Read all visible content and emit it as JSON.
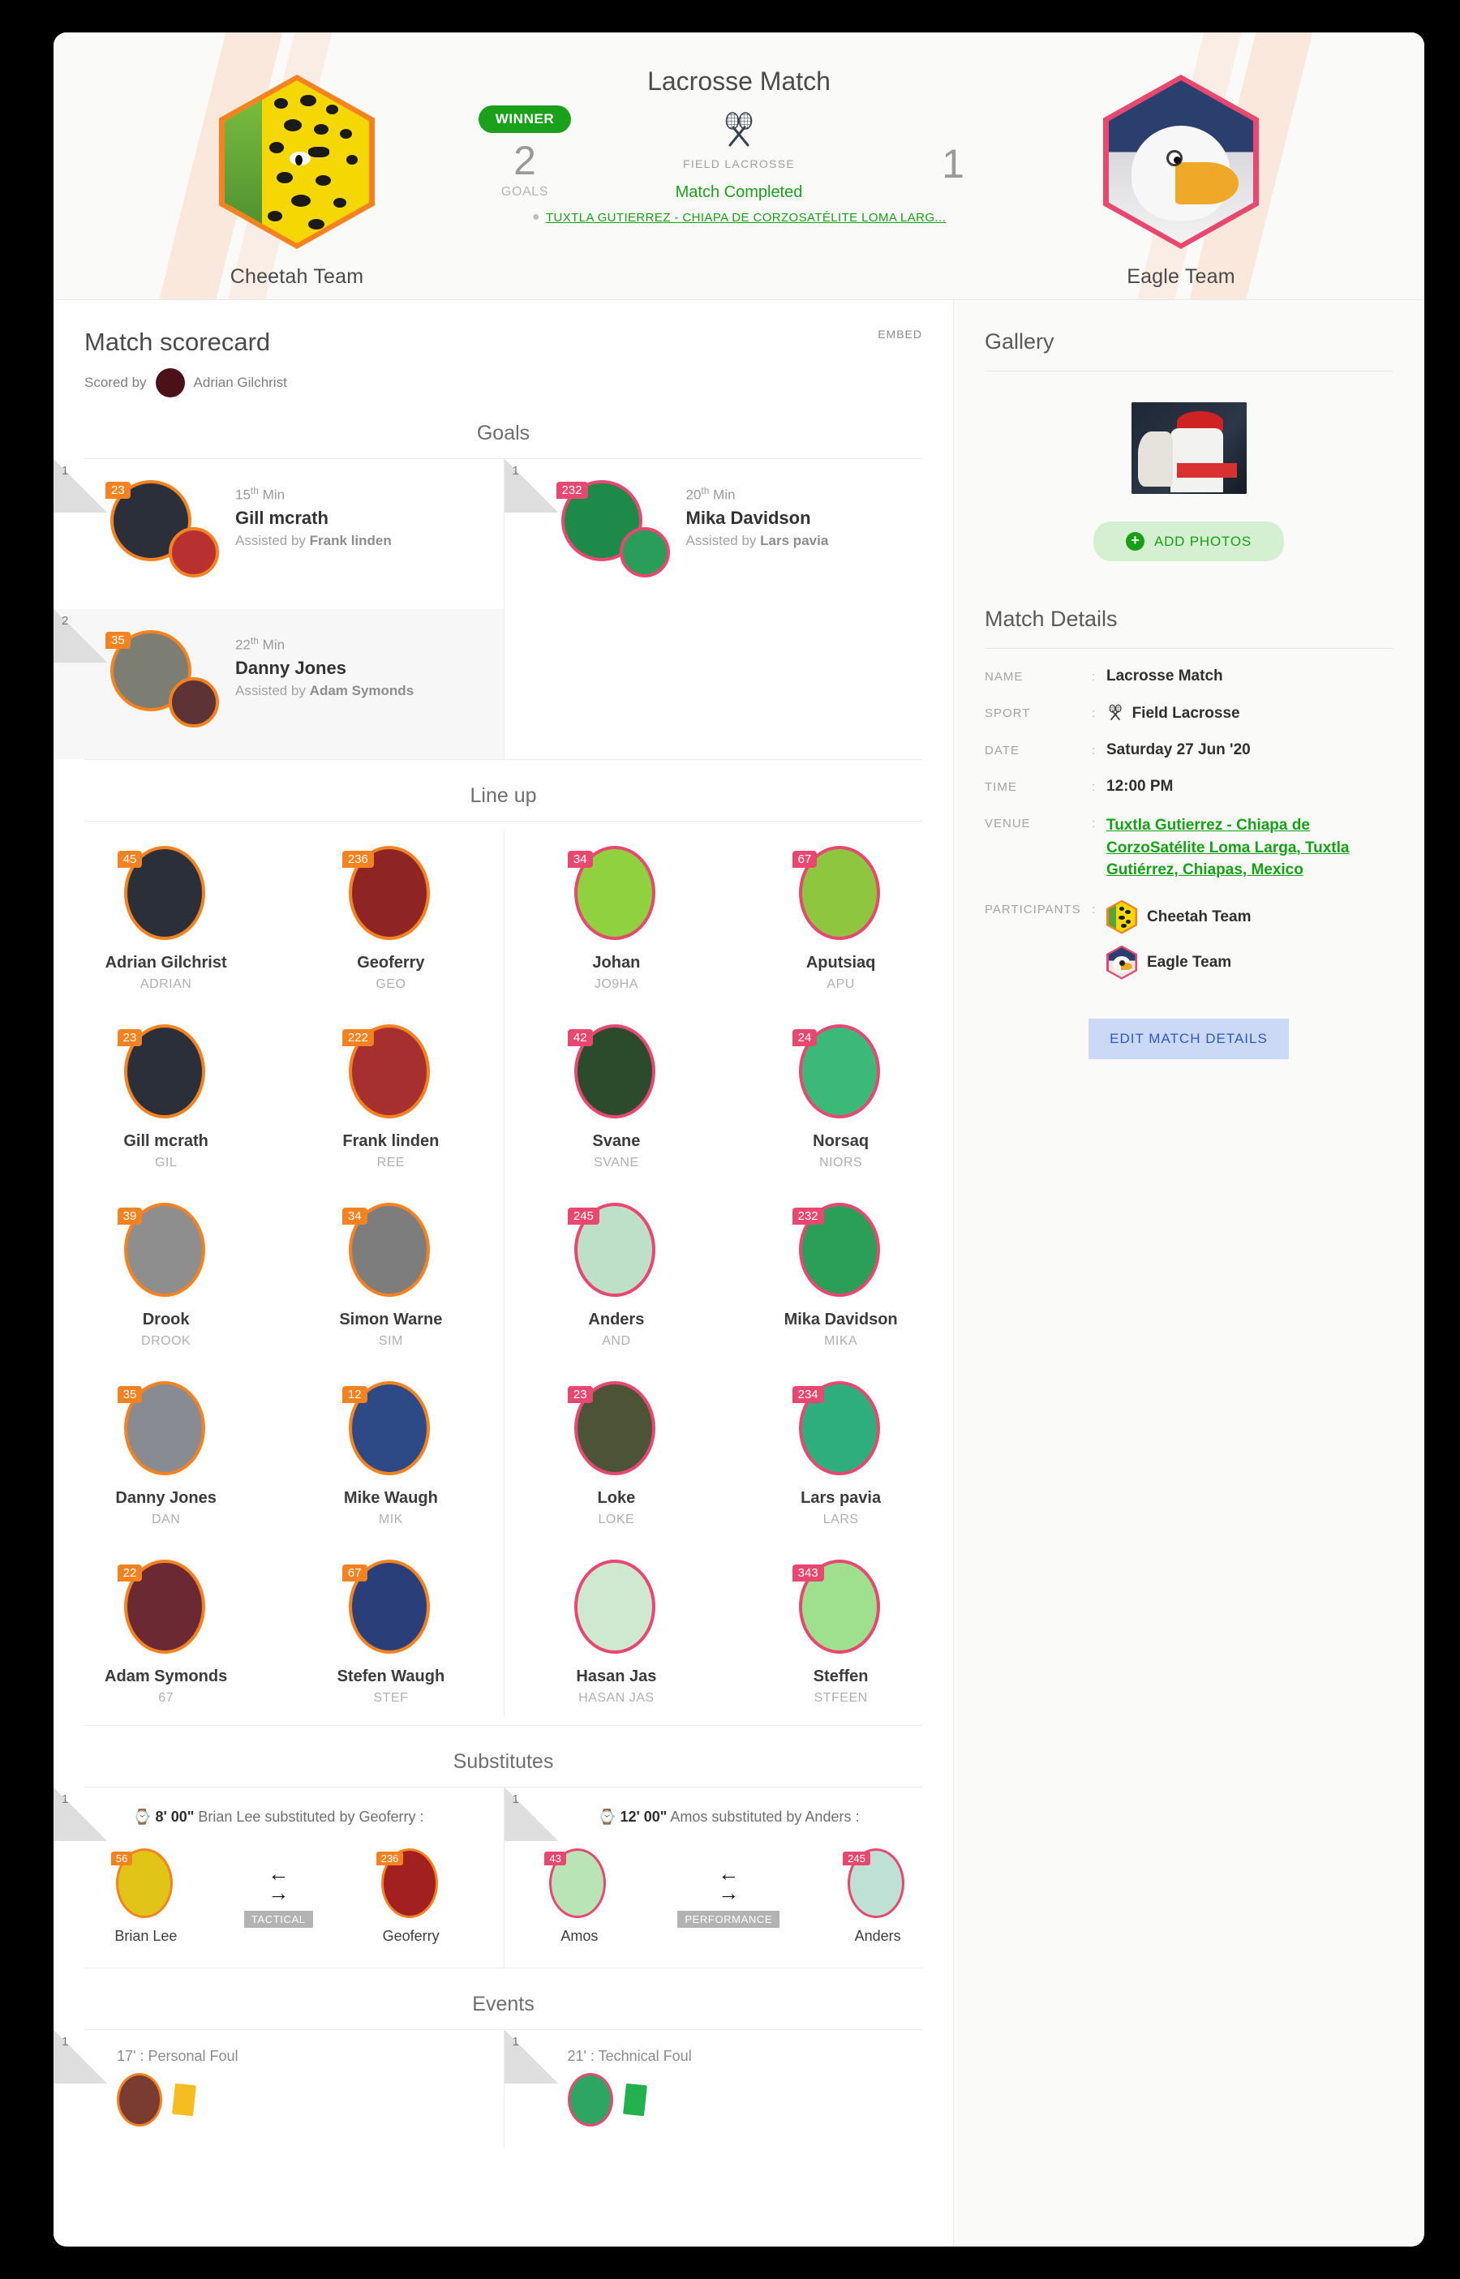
{
  "header": {
    "match_title": "Lacrosse Match",
    "sport_icon": "crossed-lacrosse-sticks-icon",
    "sport_name": "FIELD LACROSSE",
    "status": "Match Completed",
    "venue_short": "TUXTLA GUTIERREZ - CHIAPA DE CORZOSATÉLITE LOMA LARG...",
    "location_pin_icon": "map-pin-icon",
    "home": {
      "name": "Cheetah Team",
      "score": "2",
      "score_label": "GOALS",
      "badge": "WINNER"
    },
    "away": {
      "name": "Eagle Team",
      "score": "1"
    }
  },
  "scorecard": {
    "title": "Match scorecard",
    "embed_label": "EMBED",
    "scored_by_label": "Scored by",
    "scorer_name": "Adrian Gilchrist"
  },
  "sections": {
    "goals": "Goals",
    "lineup": "Line up",
    "substitutes": "Substitutes",
    "events": "Events"
  },
  "goals": {
    "home": [
      {
        "index": "1",
        "minute": "15",
        "ordinal": "th",
        "min_label": "Min",
        "player": "Gill mcrath",
        "number": "23",
        "assist_label": "Assisted by",
        "assist": "Frank linden"
      },
      {
        "index": "2",
        "minute": "22",
        "ordinal": "th",
        "min_label": "Min",
        "player": "Danny Jones",
        "number": "35",
        "assist_label": "Assisted by",
        "assist": "Adam Symonds"
      }
    ],
    "away": [
      {
        "index": "1",
        "minute": "20",
        "ordinal": "th",
        "min_label": "Min",
        "player": "Mika Davidson",
        "number": "232",
        "assist_label": "Assisted by",
        "assist": "Lars pavia"
      }
    ]
  },
  "lineup": {
    "home": [
      {
        "number": "45",
        "name": "Adrian Gilchrist",
        "alias": "ADRIAN"
      },
      {
        "number": "236",
        "name": "Geoferry",
        "alias": "GEO"
      },
      {
        "number": "23",
        "name": "Gill mcrath",
        "alias": "GIL"
      },
      {
        "number": "222",
        "name": "Frank linden",
        "alias": "REE"
      },
      {
        "number": "39",
        "name": "Drook",
        "alias": "DROOK"
      },
      {
        "number": "34",
        "name": "Simon Warne",
        "alias": "SIM"
      },
      {
        "number": "35",
        "name": "Danny Jones",
        "alias": "DAN"
      },
      {
        "number": "12",
        "name": "Mike Waugh",
        "alias": "MIK"
      },
      {
        "number": "22",
        "name": "Adam Symonds",
        "alias": "67"
      },
      {
        "number": "67",
        "name": "Stefen Waugh",
        "alias": "STEF"
      }
    ],
    "away": [
      {
        "number": "34",
        "name": "Johan",
        "alias": "JO9HA"
      },
      {
        "number": "67",
        "name": "Aputsiaq",
        "alias": "APU"
      },
      {
        "number": "42",
        "name": "Svane",
        "alias": "SVANE"
      },
      {
        "number": "24",
        "name": "Norsaq",
        "alias": "NIORS"
      },
      {
        "number": "245",
        "name": "Anders",
        "alias": "AND"
      },
      {
        "number": "232",
        "name": "Mika Davidson",
        "alias": "MIKA"
      },
      {
        "number": "23",
        "name": "Loke",
        "alias": "LOKE"
      },
      {
        "number": "234",
        "name": "Lars pavia",
        "alias": "LARS"
      },
      {
        "number": "",
        "name": "Hasan Jas",
        "alias": "HASAN JAS"
      },
      {
        "number": "343",
        "name": "Steffen",
        "alias": "STFEEN"
      }
    ]
  },
  "substitutes": {
    "home": {
      "index": "1",
      "time": "8' 00\"",
      "text_before": "Brian Lee substituted by Geoferry :",
      "out": {
        "number": "56",
        "name": "Brian Lee"
      },
      "in": {
        "number": "236",
        "name": "Geoferry"
      },
      "reason": "TACTICAL"
    },
    "away": {
      "index": "1",
      "time": "12' 00\"",
      "text_before": "Amos substituted by Anders :",
      "out": {
        "number": "43",
        "name": "Amos"
      },
      "in": {
        "number": "245",
        "name": "Anders"
      },
      "reason": "PERFORMANCE"
    }
  },
  "events": {
    "home": [
      {
        "index": "1",
        "text": "17' : Personal Foul",
        "card_color": "#f5bd1f"
      }
    ],
    "away": [
      {
        "index": "1",
        "text": "21' : Technical Foul",
        "card_color": "#22b14c"
      }
    ]
  },
  "gallery": {
    "title": "Gallery",
    "add_photos_label": "ADD PHOTOS",
    "plus_icon": "plus-icon",
    "photo_count": 1
  },
  "match_details": {
    "title": "Match Details",
    "rows": [
      {
        "key": "NAME",
        "value": "Lacrosse Match"
      },
      {
        "key": "SPORT",
        "value": "Field Lacrosse"
      },
      {
        "key": "DATE",
        "value": "Saturday 27 Jun '20"
      },
      {
        "key": "TIME",
        "value": "12:00 PM"
      },
      {
        "key": "VENUE",
        "value": "Tuxtla Gutierrez - Chiapa de CorzoSatélite Loma Larga, Tuxtla Gutiérrez, Chiapas, Mexico"
      },
      {
        "key": "PARTICIPANTS",
        "value": ""
      }
    ],
    "participants": [
      "Cheetah Team",
      "Eagle Team"
    ],
    "edit_button": "EDIT MATCH DETAILS",
    "separator": ":"
  },
  "colors": {
    "home_accent": "#f58220",
    "away_accent": "#e8486f",
    "green": "#16a016",
    "winner_green": "#1aa01a"
  }
}
